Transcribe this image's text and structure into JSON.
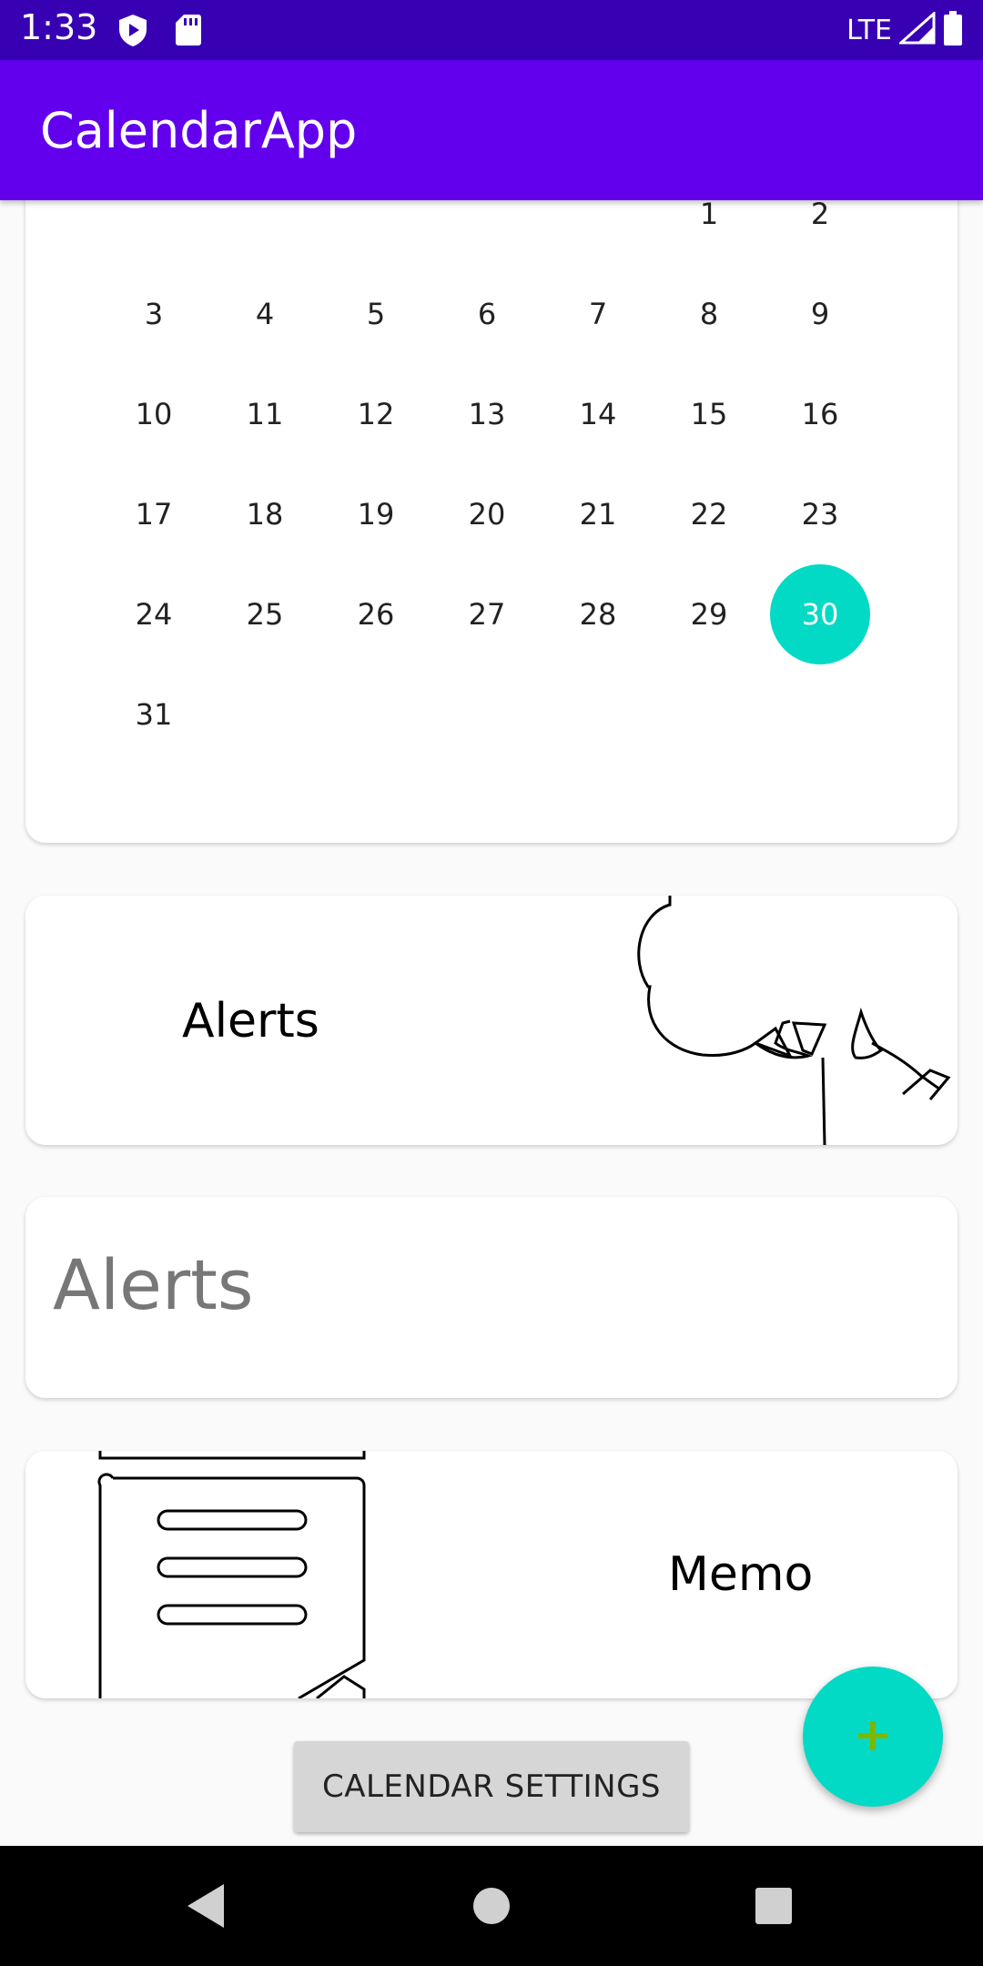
{
  "status_bar": {
    "time": "1:33",
    "network": "LTE",
    "icons": [
      "shield-icon",
      "sd-card-icon",
      "signal-icon",
      "battery-icon"
    ]
  },
  "app_bar": {
    "title": "CalendarApp"
  },
  "calendar": {
    "days": [
      "",
      "",
      "",
      "",
      "",
      "1",
      "2",
      "3",
      "4",
      "5",
      "6",
      "7",
      "8",
      "9",
      "10",
      "11",
      "12",
      "13",
      "14",
      "15",
      "16",
      "17",
      "18",
      "19",
      "20",
      "21",
      "22",
      "23",
      "24",
      "25",
      "26",
      "27",
      "28",
      "29",
      "30",
      "31"
    ],
    "selected_day": "30",
    "accent_color": "#03dac5"
  },
  "alerts_card": {
    "label": "Alerts"
  },
  "alerts_input": {
    "placeholder": "Alerts",
    "value": ""
  },
  "memo_card": {
    "label": "Memo"
  },
  "settings_button": {
    "label": "CALENDAR SETTINGS"
  },
  "fab": {
    "icon": "plus-icon"
  },
  "colors": {
    "primary": "#6200ee",
    "primary_dark": "#3700b3",
    "accent": "#03dac5"
  }
}
